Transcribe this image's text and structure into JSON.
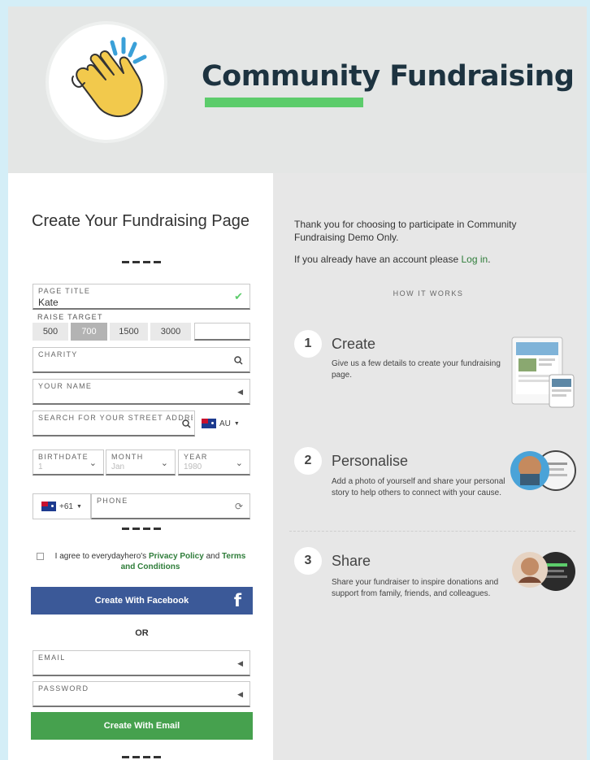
{
  "header": {
    "title": "Community Fundraising",
    "logo_icon": "clapping-hands-icon",
    "accent_color": "#5ccc6b",
    "title_color": "#1d3340"
  },
  "form": {
    "title": "Create Your Fundraising Page",
    "page_title": {
      "label": "PAGE TITLE",
      "value": "Kate"
    },
    "raise_target": {
      "label": "RAISE TARGET",
      "options": [
        "500",
        "700",
        "1500",
        "3000"
      ],
      "selected": "700",
      "other_value": ""
    },
    "charity": {
      "label": "CHARITY",
      "value": ""
    },
    "your_name": {
      "label": "YOUR NAME",
      "value": ""
    },
    "address": {
      "label": "SEARCH FOR YOUR STREET ADDRESS",
      "country": "AU"
    },
    "birthdate": {
      "day_label": "BIRTHDATE",
      "day_placeholder": "1",
      "month_label": "MONTH",
      "month_placeholder": "Jan",
      "year_label": "YEAR",
      "year_placeholder": "1980"
    },
    "phone": {
      "country_code": "+61",
      "label": "PHONE",
      "value": ""
    },
    "agree": {
      "prefix": "I agree to everydayhero's",
      "privacy": "Privacy Policy",
      "and": "and",
      "terms": "Terms and Conditions"
    },
    "facebook_button": "Create With Facebook",
    "facebook_icon_glyph": "f",
    "or": "OR",
    "email": {
      "label": "EMAIL",
      "value": ""
    },
    "password": {
      "label": "PASSWORD",
      "value": ""
    },
    "email_button": "Create With Email",
    "colors": {
      "facebook": "#3b5998",
      "email_button": "#46a14e"
    }
  },
  "info": {
    "thanks": "Thank you for choosing to participate in Community Fundraising Demo Only.",
    "account_prefix": "If you already have an account please",
    "login_link": "Log in",
    "account_suffix": ".",
    "how_it_works": "HOW IT WORKS",
    "steps": [
      {
        "number": "1",
        "title": "Create",
        "desc": "Give us a few details to create your fundraising page."
      },
      {
        "number": "2",
        "title": "Personalise",
        "desc": "Add a photo of yourself and share your personal story to help others to connect with your cause."
      },
      {
        "number": "3",
        "title": "Share",
        "desc": "Share your fundraiser to inspire donations and support from family, friends, and colleagues."
      }
    ]
  }
}
